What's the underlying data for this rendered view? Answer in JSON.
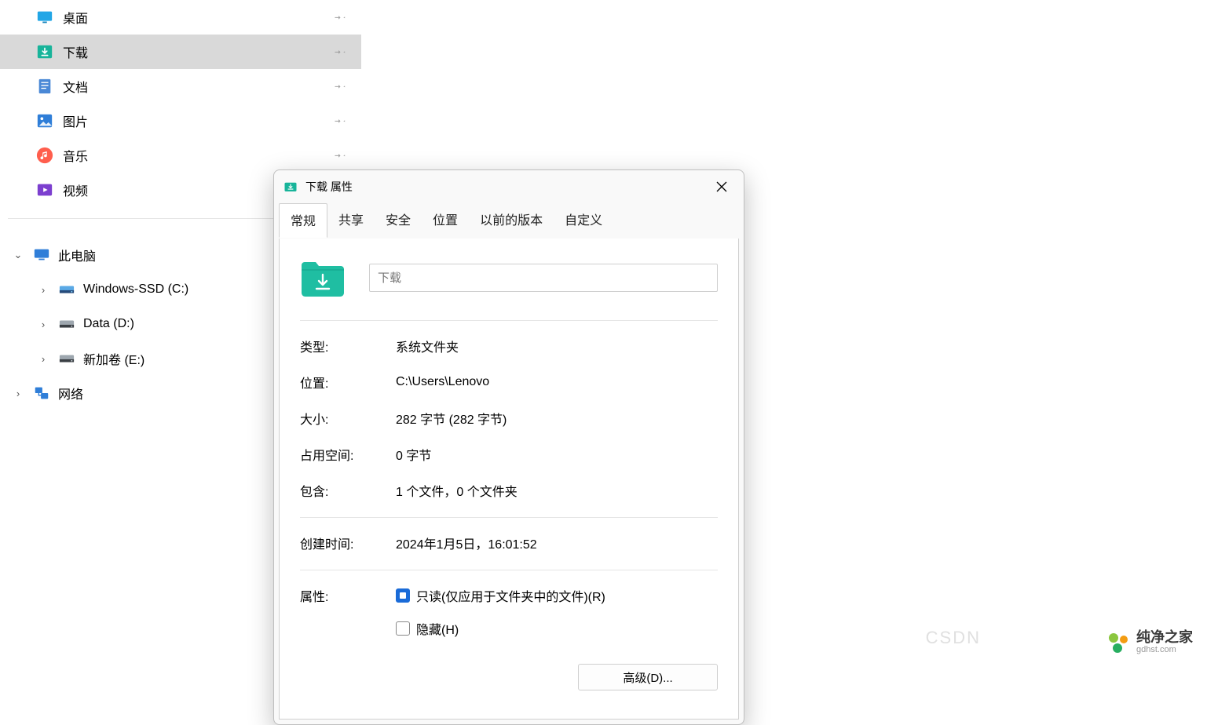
{
  "sidebar": {
    "quick": [
      {
        "icon": "desktop",
        "label": "桌面"
      },
      {
        "icon": "download",
        "label": "下载"
      },
      {
        "icon": "document",
        "label": "文档"
      },
      {
        "icon": "picture",
        "label": "图片"
      },
      {
        "icon": "music",
        "label": "音乐"
      },
      {
        "icon": "video",
        "label": "视频"
      }
    ],
    "thispc": {
      "label": "此电脑"
    },
    "drives": [
      {
        "label": "Windows-SSD (C:)"
      },
      {
        "label": "Data (D:)"
      },
      {
        "label": "新加卷 (E:)"
      }
    ],
    "network": {
      "label": "网络"
    }
  },
  "dialog": {
    "title": "下载 属性",
    "tabs": [
      "常规",
      "共享",
      "安全",
      "位置",
      "以前的版本",
      "自定义"
    ],
    "name_placeholder": "下载",
    "rows": {
      "type_k": "类型:",
      "type_v": "系统文件夹",
      "loc_k": "位置:",
      "loc_v": "C:\\Users\\Lenovo",
      "size_k": "大小:",
      "size_v": "282 字节 (282 字节)",
      "disk_k": "占用空间:",
      "disk_v": "0 字节",
      "contains_k": "包含:",
      "contains_v": "1 个文件，0 个文件夹",
      "created_k": "创建时间:",
      "created_v": "2024年1月5日，16:01:52",
      "attr_k": "属性:"
    },
    "readonly_label": "只读(仅应用于文件夹中的文件)(R)",
    "hidden_label": "隐藏(H)",
    "advanced_label": "高级(D)..."
  },
  "watermark": {
    "csdn": "CSDN",
    "brand_title": "纯净之家",
    "brand_sub": "gdhst.com"
  }
}
